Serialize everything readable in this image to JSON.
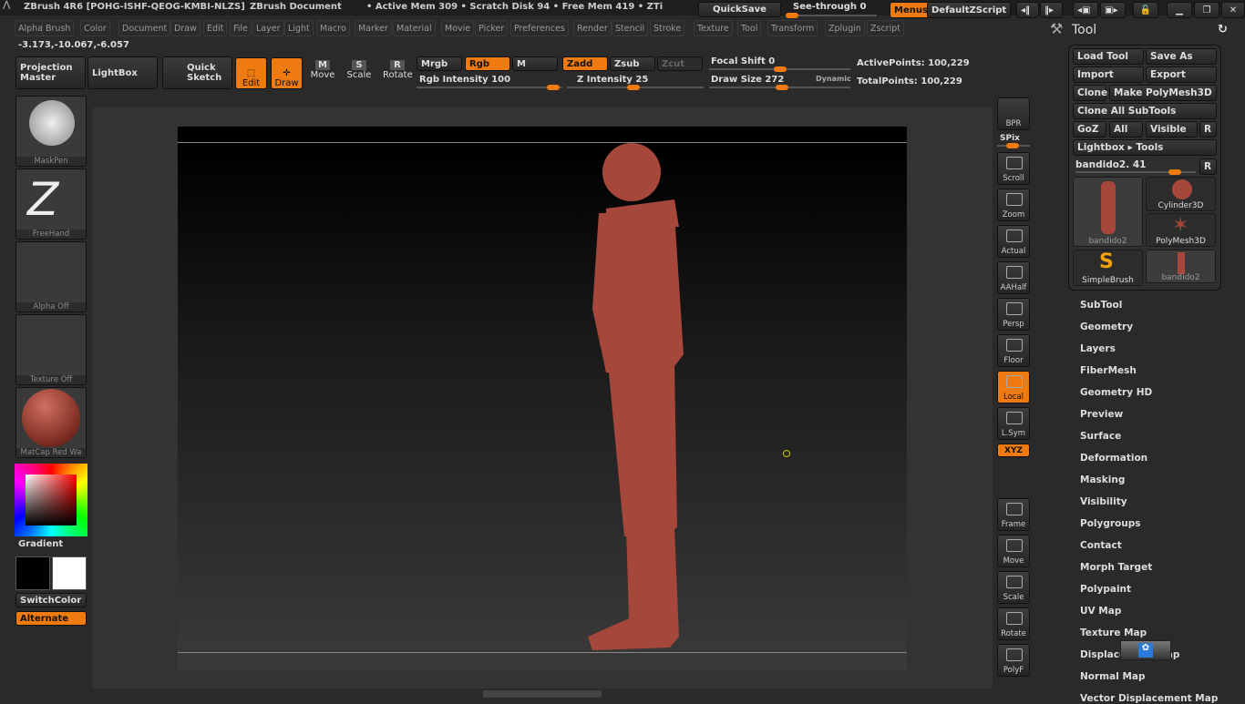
{
  "title": {
    "app": "ZBrush 4R6 [POHG-ISHF-QEOG-KMBI-NLZS]",
    "doc": "ZBrush Document",
    "stats": "• Active Mem 309 • Scratch Disk 94 • Free Mem 419 • ZTi"
  },
  "top": {
    "quicksave": "QuickSave",
    "seethrough": "See-through  0",
    "menus": "Menus",
    "script": "DefaultZScript"
  },
  "menus": [
    "Alpha",
    "Brush",
    "Color",
    "Document",
    "Draw",
    "Edit",
    "File",
    "Layer",
    "Light",
    "Macro",
    "Marker",
    "Material",
    "Movie",
    "Picker",
    "Preferences",
    "Render",
    "Stencil",
    "Stroke",
    "Texture",
    "Tool",
    "Transform",
    "Zplugin",
    "Zscript"
  ],
  "coords": "-3.173,-10.067,-6.057",
  "toolbar": {
    "projection": "Projection Master",
    "lightbox": "LightBox",
    "quick": "Quick Sketch",
    "edit": "Edit",
    "draw": "Draw",
    "move": "Move",
    "scale": "Scale",
    "rotate": "Rotate",
    "mrgb": "Mrgb",
    "rgb": "Rgb",
    "m": "M",
    "zadd": "Zadd",
    "zsub": "Zsub",
    "zcut": "Zcut",
    "rgb_intensity": "Rgb Intensity 100",
    "z_intensity": "Z Intensity 25",
    "focal": "Focal Shift 0",
    "drawsize": "Draw Size 272",
    "dynamic": "Dynamic",
    "active": "ActivePoints: 100,229",
    "total": "TotalPoints: 100,229"
  },
  "left": {
    "maskpen": "MaskPen",
    "freehand": "FreeHand",
    "alpha": "Alpha  Off",
    "texture": "Texture  Off",
    "matcap": "MatCap  Red  Wa",
    "gradient": "Gradient",
    "switch": "SwitchColor",
    "alternate": "Alternate"
  },
  "right_shelf": [
    "BPR",
    "SPix",
    "Scroll",
    "Zoom",
    "Actual",
    "AAHalf",
    "Persp",
    "Floor",
    "Local",
    "L.Sym",
    "XYZ",
    "Frame",
    "Move",
    "Scale",
    "Rotate",
    "PolyF"
  ],
  "tool": {
    "title": "Tool",
    "load": "Load Tool",
    "saveas": "Save As",
    "import": "Import",
    "export": "Export",
    "clone": "Clone",
    "make": "Make PolyMesh3D",
    "cloneall": "Clone All SubTools",
    "goz": "GoZ",
    "all": "All",
    "visible": "Visible",
    "r": "R",
    "lightbox": "Lightbox ▸ Tools",
    "current": "bandido2. 41",
    "thumbs": [
      "bandido2",
      "Cylinder3D",
      "PolyMesh3D",
      "SimpleBrush",
      "bandido2"
    ],
    "sections": [
      "SubTool",
      "Geometry",
      "Layers",
      "FiberMesh",
      "Geometry HD",
      "Preview",
      "Surface",
      "Deformation",
      "Masking",
      "Visibility",
      "Polygroups",
      "Contact",
      "Morph Target",
      "Polypaint",
      "UV Map",
      "Texture Map",
      "Displacement Map",
      "Normal Map",
      "Vector Displacement Map"
    ]
  },
  "colors": {
    "accent": "#ee7a10",
    "model": "#a5473a"
  }
}
